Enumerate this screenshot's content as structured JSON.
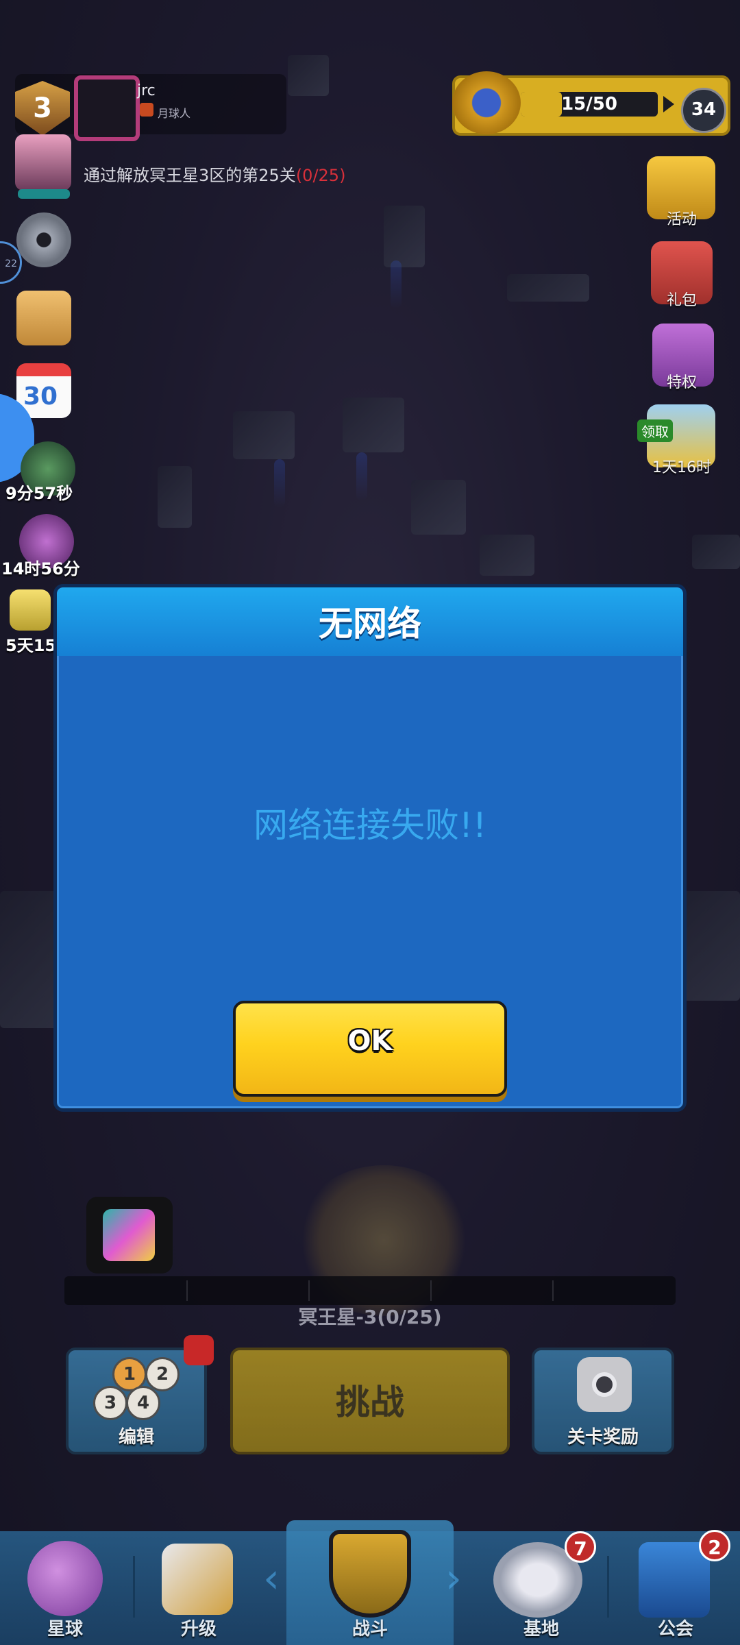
{
  "hud": {
    "player_level": "3",
    "player_name": "jrc",
    "player_title": "月球人",
    "rank_progress": "15/50",
    "rank_value": "34",
    "quest_text": "通过解放冥王星3区的第25关",
    "quest_progress": "(0/25)"
  },
  "left_side": {
    "ring_badge": "22",
    "calendar_day": "30",
    "timer_1": "9分57秒",
    "timer_2": "14时56分",
    "timer_3": "5天15"
  },
  "right_side": {
    "items": [
      {
        "label": "活动",
        "icon": "trophy-icon"
      },
      {
        "label": "礼包",
        "icon": "gift-icon"
      },
      {
        "label": "特权",
        "icon": "crown-icon"
      },
      {
        "label": "1天16时",
        "icon": "coins-icon"
      }
    ],
    "coins_tag": "领取"
  },
  "stage": {
    "label": "冥王星-3(0/25)"
  },
  "actions": {
    "edit_label": "编辑",
    "hex_numbers": [
      "1",
      "2",
      "3",
      "4"
    ],
    "challenge_label": "挑战",
    "reward_label": "关卡奖励"
  },
  "nav": {
    "items": [
      {
        "label": "星球",
        "badge": ""
      },
      {
        "label": "升级",
        "badge": ""
      },
      {
        "label": "战斗",
        "badge": ""
      },
      {
        "label": "基地",
        "badge": "7"
      },
      {
        "label": "公会",
        "badge": "2"
      }
    ]
  },
  "dialog": {
    "title": "无网络",
    "message": "网络连接失败!!",
    "ok_label": "OK"
  },
  "colors": {
    "dialog_bg": "#1d68c0",
    "dialog_header": "#20a8ee",
    "message_text": "#38a9ef",
    "ok_button": "#ffd21e"
  }
}
